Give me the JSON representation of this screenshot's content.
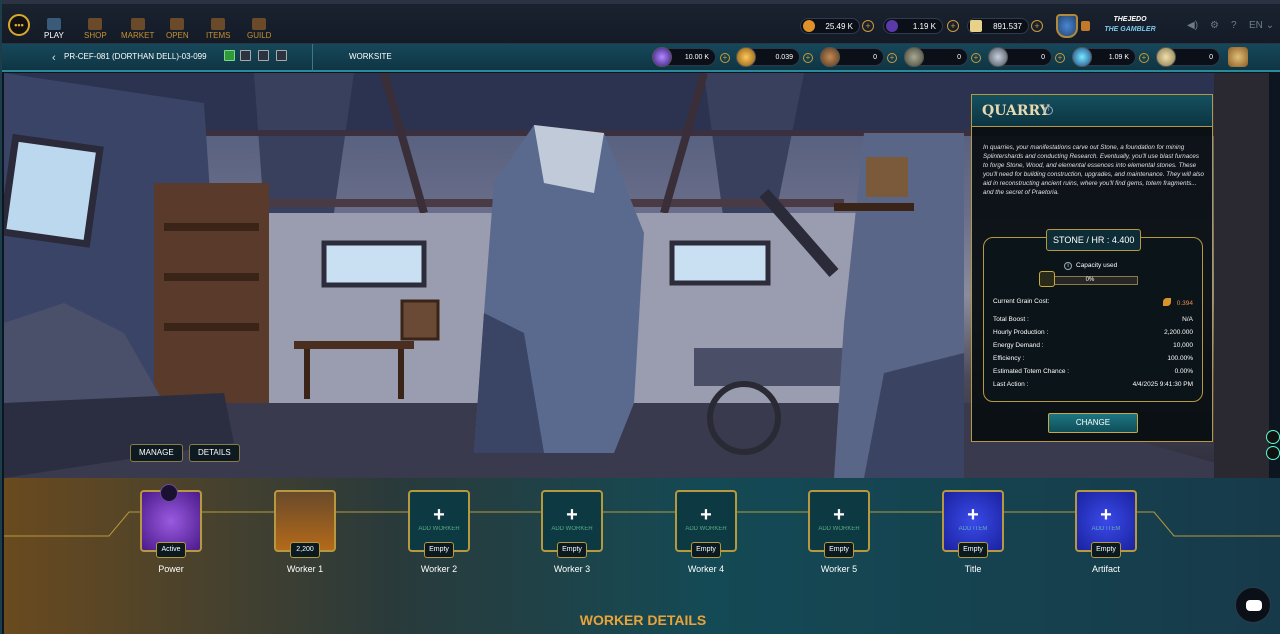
{
  "nav": {
    "items": [
      "PLAY",
      "SHOP",
      "MARKET",
      "OPEN",
      "ITEMS",
      "GUILD"
    ],
    "currencies": [
      "25.49 K",
      "1.19 K",
      "891.537"
    ],
    "user": {
      "name": "THEJEDO",
      "title": "THE GAMBLER"
    },
    "language": "EN"
  },
  "subheader": {
    "plot_id": "PR-CEF-081 (DORTHAN DELL)-03-099",
    "tab": "WORKSITE",
    "resources": [
      "10.00 K",
      "0.039",
      "0",
      "0",
      "0",
      "1.09 K",
      "0"
    ]
  },
  "scene": {
    "manage_label": "MANAGE",
    "details_label": "DETAILS"
  },
  "quarry": {
    "title": "QUARRY",
    "description": "In quarries, your manifestations carve out Stone, a foundation for mining Splintershards and conducting Research. Eventually, you'll use blast furnaces to forge Stone, Wood, and elemental essences into elemental stones. These you'll need for building construction, upgrades, and maintenance. They will also aid in reconstructing ancient ruins, where you'll find gems, totem fragments... and the secret of Praetoria.",
    "rate": "STONE / HR : 4.400",
    "capacity_label": "Capacity used",
    "capacity_value": "0%",
    "capacity_fraction": 0,
    "grain_label": "Current Grain Cost:",
    "grain_value": "0.394",
    "stats": [
      {
        "label": "Total Boost :",
        "value": "N/A"
      },
      {
        "label": "Hourly Production :",
        "value": "2,200.000"
      },
      {
        "label": "Energy Demand :",
        "value": "10,000"
      },
      {
        "label": "Efficiency :",
        "value": "100.00%"
      },
      {
        "label": "Estimated Totem Chance :",
        "value": "0.00%"
      },
      {
        "label": "Last Action :",
        "value": "4/4/2025 9:41:30 PM"
      }
    ],
    "change_label": "CHANGE"
  },
  "slots": [
    {
      "label": "Power",
      "badge": "Active",
      "kind": "power",
      "add": ""
    },
    {
      "label": "Worker 1",
      "badge": "2,200",
      "kind": "w1",
      "add": ""
    },
    {
      "label": "Worker 2",
      "badge": "Empty",
      "kind": "empty",
      "add": "ADD WORKER"
    },
    {
      "label": "Worker 3",
      "badge": "Empty",
      "kind": "empty",
      "add": "ADD WORKER"
    },
    {
      "label": "Worker 4",
      "badge": "Empty",
      "kind": "empty",
      "add": "ADD WORKER"
    },
    {
      "label": "Worker 5",
      "badge": "Empty",
      "kind": "empty",
      "add": "ADD WORKER"
    },
    {
      "label": "Title",
      "badge": "Empty",
      "kind": "item",
      "add": "ADD ITEM"
    },
    {
      "label": "Artifact",
      "badge": "Empty",
      "kind": "item",
      "add": "ADD ITEM"
    }
  ],
  "worker_details_title": "WORKER DETAILS"
}
